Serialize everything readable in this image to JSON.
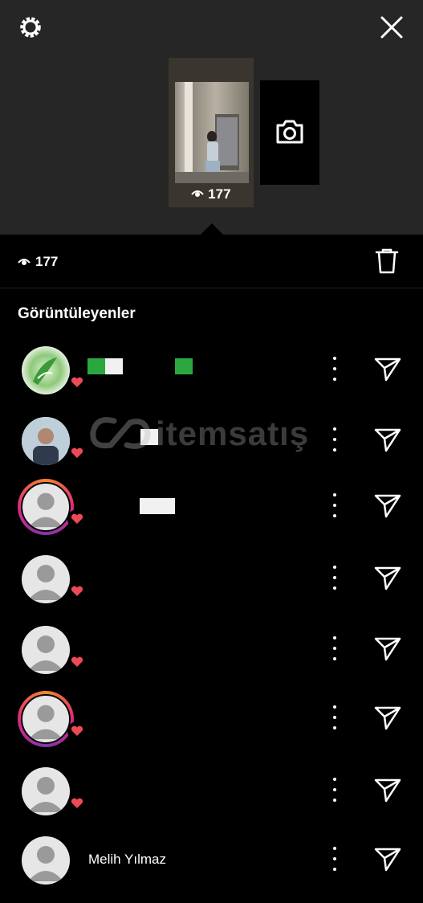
{
  "story": {
    "views_count": "177"
  },
  "header": {
    "viewers_title": "Görüntüleyenler"
  },
  "viewers": [
    {
      "name": "",
      "ring": false,
      "avatar": "photo-green"
    },
    {
      "name": "",
      "ring": false,
      "avatar": "photo-person"
    },
    {
      "name": "",
      "ring": true,
      "avatar": "default"
    },
    {
      "name": "",
      "ring": false,
      "avatar": "default"
    },
    {
      "name": "",
      "ring": false,
      "avatar": "default"
    },
    {
      "name": "",
      "ring": true,
      "avatar": "default"
    },
    {
      "name": "",
      "ring": false,
      "avatar": "default"
    },
    {
      "name": "Melih Yılmaz",
      "ring": false,
      "avatar": "default"
    }
  ],
  "watermark": {
    "text": "itemsatış"
  },
  "colors": {
    "top_bg": "#262626",
    "heart": "#ed4956",
    "ring_start": "#f58529",
    "ring_end": "#8134af"
  }
}
